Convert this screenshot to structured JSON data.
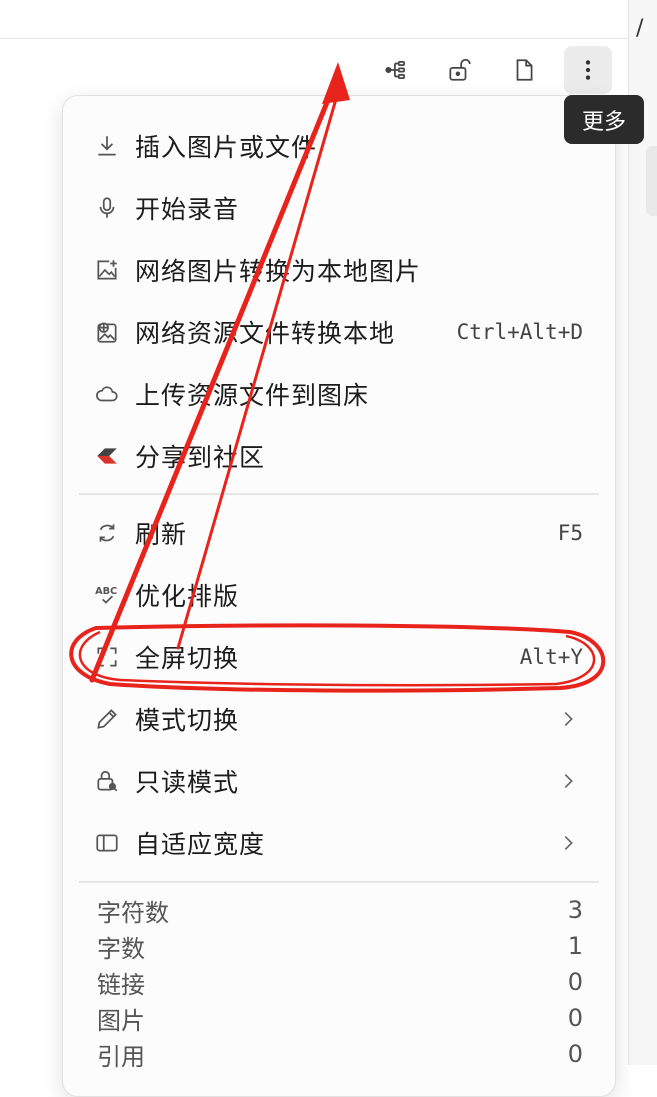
{
  "side": {
    "slash": "/"
  },
  "toolbar": {
    "outline_icon": "outline-icon",
    "lock_icon": "unlock-icon",
    "doc_icon": "document-icon",
    "more_icon": "more-vertical-icon"
  },
  "tooltip": {
    "text": "更多"
  },
  "menu": {
    "groups": [
      [
        {
          "label": "插入图片或文件",
          "icon": "download-icon"
        },
        {
          "label": "开始录音",
          "icon": "microphone-icon"
        },
        {
          "label": "网络图片转换为本地图片",
          "icon": "image-add-icon"
        },
        {
          "label": "网络资源文件转换本地",
          "icon": "image-web-icon",
          "shortcut": "Ctrl+Alt+D"
        },
        {
          "label": "上传资源文件到图床",
          "icon": "cloud-icon"
        },
        {
          "label": "分享到社区",
          "icon": "share-community-icon"
        }
      ],
      [
        {
          "label": "刷新",
          "icon": "refresh-icon",
          "shortcut": "F5"
        },
        {
          "label": "优化排版",
          "icon": "abc-check-icon"
        },
        {
          "label": "全屏切换",
          "icon": "fullscreen-icon",
          "shortcut": "Alt+Y"
        },
        {
          "label": "模式切换",
          "icon": "pencil-icon",
          "submenu": true
        },
        {
          "label": "只读模式",
          "icon": "lock-key-icon",
          "submenu": true
        },
        {
          "label": "自适应宽度",
          "icon": "panel-icon",
          "submenu": true
        }
      ]
    ],
    "stats": [
      {
        "label": "字符数",
        "value": "3"
      },
      {
        "label": "字数",
        "value": "1"
      },
      {
        "label": "链接",
        "value": "0"
      },
      {
        "label": "图片",
        "value": "0"
      },
      {
        "label": "引用",
        "value": "0"
      }
    ]
  },
  "colors": {
    "annotation_red": "#e8231c",
    "tooltip_bg": "#2b2b2b",
    "menu_bg": "#fcfcfc"
  }
}
